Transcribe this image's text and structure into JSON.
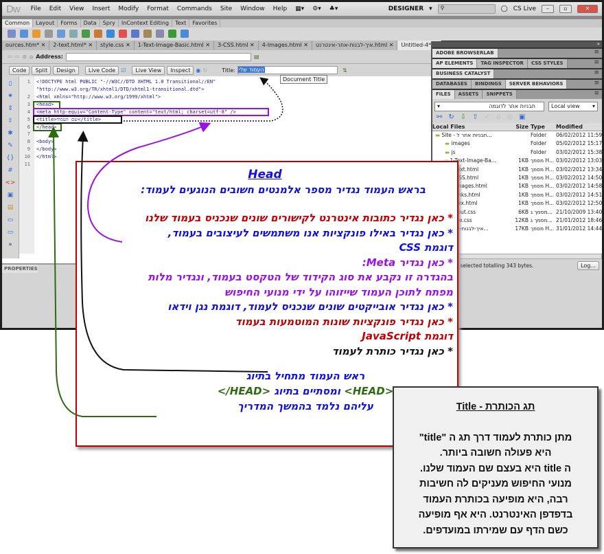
{
  "app": {
    "logo": "Dw",
    "menu": [
      "File",
      "Edit",
      "View",
      "Insert",
      "Modify",
      "Format",
      "Commands",
      "Site",
      "Window",
      "Help"
    ],
    "workspace": "DESIGNER",
    "cs_live": "CS Live",
    "window_buttons": [
      "minimize",
      "restore",
      "close"
    ]
  },
  "insert_tabs": [
    "Common",
    "Layout",
    "Forms",
    "Data",
    "Spry",
    "InContext Editing",
    "Text",
    "Favorites"
  ],
  "doc_tabs": [
    "ources.htm*",
    "2-text.html*",
    "style.css",
    "1-Text-Image-Basic.html",
    "3-CSS.html",
    "4-Images.html",
    "איך-לבנות-אתר-אינטרנט.html",
    "Untitled-4*"
  ],
  "address": {
    "label": "Address:",
    "value": ""
  },
  "doc_toolbar": {
    "code": "Code",
    "split": "Split",
    "design": "Design",
    "live_code": "Live Code",
    "live_view": "Live View",
    "inspect": "Inspect",
    "title_label": "Title:",
    "title_value": "העמוד שלי",
    "tooltip": "Document Title"
  },
  "code": {
    "line_numbers": [
      "1",
      "",
      "2",
      "3",
      "4",
      "5",
      "6",
      "7",
      "8",
      "9",
      "10",
      "11"
    ],
    "lines": [
      "<!DOCTYPE html PUBLIC \"-//W3C//DTD XHTML 1.0 Transitional//EN\"",
      "\"http://www.w3.org/TR/xhtml1/DTD/xhtml1-transitional.dtd\">",
      "<html xmlns=\"http://www.w3.org/1999/xhtml\">",
      "<head>",
      "<meta http-equiv=\"Content-Type\" content=\"text/html; charset=utf-8\" />",
      "<title>שם העמוד</title>",
      "</head>",
      "",
      "<body>",
      "</body>",
      "</html>",
      ""
    ]
  },
  "properties": {
    "label": "PROPERTIES"
  },
  "right_panel": {
    "groups": [
      [
        "ADOBE BROWSERLAB"
      ],
      [
        "AP ELEMENTS",
        "TAG INSPECTOR",
        "CSS STYLES"
      ],
      [
        "BUSINESS CATALYST"
      ],
      [
        "DATABASES",
        "BINDINGS",
        "SERVER BEHAVIORS"
      ],
      [
        "FILES",
        "ASSETS",
        "SNIPPETS"
      ]
    ],
    "site_select": "תבניות אתר לדוגמה",
    "view_select": "Local view",
    "columns": [
      "Local Files",
      "Size",
      "Type",
      "Modified"
    ],
    "files": [
      [
        "Site - תבניות אתר ל...",
        "",
        "Folder",
        "06/02/2012 11:59"
      ],
      [
        "images",
        "",
        "Folder",
        "05/02/2012 15:17"
      ],
      [
        "js",
        "",
        "Folder",
        "03/02/2012 15:38"
      ],
      [
        "1-Text-Image-Ba...",
        "1KB",
        "מסמך H...",
        "03/02/2012 13:03"
      ],
      [
        "2-text.html",
        "1KB",
        "מסמך H...",
        "03/02/2012 13:34"
      ],
      [
        "3-CSS.html",
        "1KB",
        "מסמך H...",
        "03/02/2012 14:50"
      ],
      [
        "4-Images.html",
        "1KB",
        "מסמך H...",
        "03/02/2012 14:58"
      ],
      [
        "5-links.html",
        "1KB",
        "מסמך H...",
        "03/02/2012 14:51"
      ],
      [
        "index.html",
        "1KB",
        "מסמך H...",
        "03/02/2012 12:50"
      ],
      [
        "layout.css",
        "6KB",
        "מסמך ג...",
        "21/10/2009 13:40"
      ],
      [
        "style.css",
        "12KB",
        "מסמך ג...",
        "21/01/2012 18:46"
      ],
      [
        "איך-לבנות-אתר...",
        "17KB",
        "מסמך H...",
        "31/01/2012 14:44"
      ]
    ],
    "status": "cal items selected totalling 343 bytes.",
    "log_button": "Log..."
  },
  "annotation": {
    "heading": "Head",
    "intro": "בראש העמוד נגדיר מספר אלמנטים חשובים הנוגעים לעמוד:",
    "links": "* כאן נגדיר כתובות אינטרנט לקישורים שונים שנכניס בעמוד שלנו",
    "css1": "* כאן נגדיר באילו פונקציות אנו משתמשים לעיצובים בעמוד,",
    "css2": "דוגמת CSS",
    "meta1": "* כאן נגדיר Meta:",
    "meta2": "בהגדרה זו נקבע את סוג הקידוד של הטקסט בעמוד, ונגדיר מלות",
    "meta3": "מפתח לתוכן העמוד שייזוהו על ידי מנועי החיפוש",
    "objects": "* כאן נגדיר אובייקטים שונים שנכניס לעמוד, דוגמת נגן וידאו",
    "js1": "* כאן נגדיר פונקציות שונות המוטמעות בעמוד",
    "js2": "דוגמת JavaScript",
    "title": "* כאן נגדיר כותרת לעמוד",
    "footer1": "ראש העמוד מתחיל בתיוג",
    "footer2_open": "<HEAD>",
    "footer2_mid": " ומסתיים בתיוג ",
    "footer2_close": "</HEAD>",
    "footer3": "עליהם נלמד בהמשך המדריך"
  },
  "title_box": {
    "heading": "תג הכותרת - Title",
    "lines": [
      "מתן כותרת לעמוד דרך תג ה \"title\"",
      "היא פעולה חשובה ביותר.",
      "ה title היא בעצם שם העמוד שלנו.",
      "מנועי החיפוש מעניקים לה חשיבות",
      "רבה, היא מופיעה בכותרת העמוד",
      "בדפדפן האינטרנט. היא אף מופיעה",
      "כשם הדף עם שמירתו במועדפים."
    ]
  },
  "colors": {
    "box_border": "#c00000",
    "head_box": "#2e6a10",
    "meta_box": "#9a10e6",
    "title_box": "#111111",
    "blue_text": "#1010e0",
    "title_highlight": "#3b76d8"
  }
}
